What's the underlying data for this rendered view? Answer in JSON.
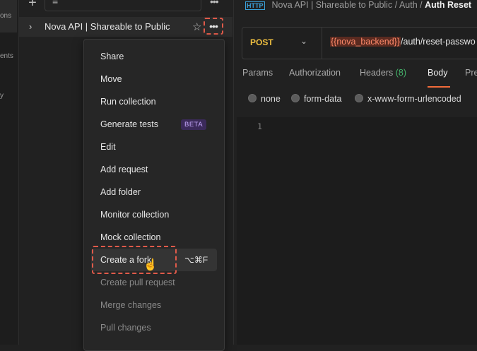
{
  "rail": {
    "labels": [
      "ons",
      "ents",
      "y"
    ]
  },
  "sidebar": {
    "collection_name": "Nova API | Shareable to Public"
  },
  "menu": {
    "items": [
      {
        "label": "Share",
        "disabled": false
      },
      {
        "label": "Move",
        "disabled": false
      },
      {
        "label": "Run collection",
        "disabled": false
      },
      {
        "label": "Generate tests",
        "disabled": false,
        "badge": "BETA"
      },
      {
        "label": "Edit",
        "disabled": false
      },
      {
        "label": "Add request",
        "disabled": false
      },
      {
        "label": "Add folder",
        "disabled": false
      },
      {
        "label": "Monitor collection",
        "disabled": false
      },
      {
        "label": "Mock collection",
        "disabled": false
      },
      {
        "label": "Create a fork",
        "disabled": false,
        "shortcut": "⌥⌘F"
      },
      {
        "label": "Create pull request",
        "disabled": true
      },
      {
        "label": "Merge changes",
        "disabled": true
      },
      {
        "label": "Pull changes",
        "disabled": true
      }
    ]
  },
  "breadcrumb": {
    "icon": "HTTP",
    "collection": "Nova API | Shareable to Public",
    "folder": "Auth",
    "current": "Auth Reset"
  },
  "request": {
    "method": "POST",
    "url_var": "{{nova_backend}}",
    "url_path": "/auth/reset-passwo"
  },
  "tabs": {
    "params": "Params",
    "authorization": "Authorization",
    "headers": "Headers",
    "headers_count": "(8)",
    "body": "Body",
    "prerequest": "Pre"
  },
  "body_types": {
    "none": "none",
    "form_data": "form-data",
    "urlencoded": "x-www-form-urlencoded"
  },
  "editor": {
    "line_number": "1"
  },
  "colors": {
    "accent": "#f26b3a",
    "highlight_dashed": "#e05a4a",
    "method_post": "#f0c040",
    "headers_count": "#45b36b"
  }
}
